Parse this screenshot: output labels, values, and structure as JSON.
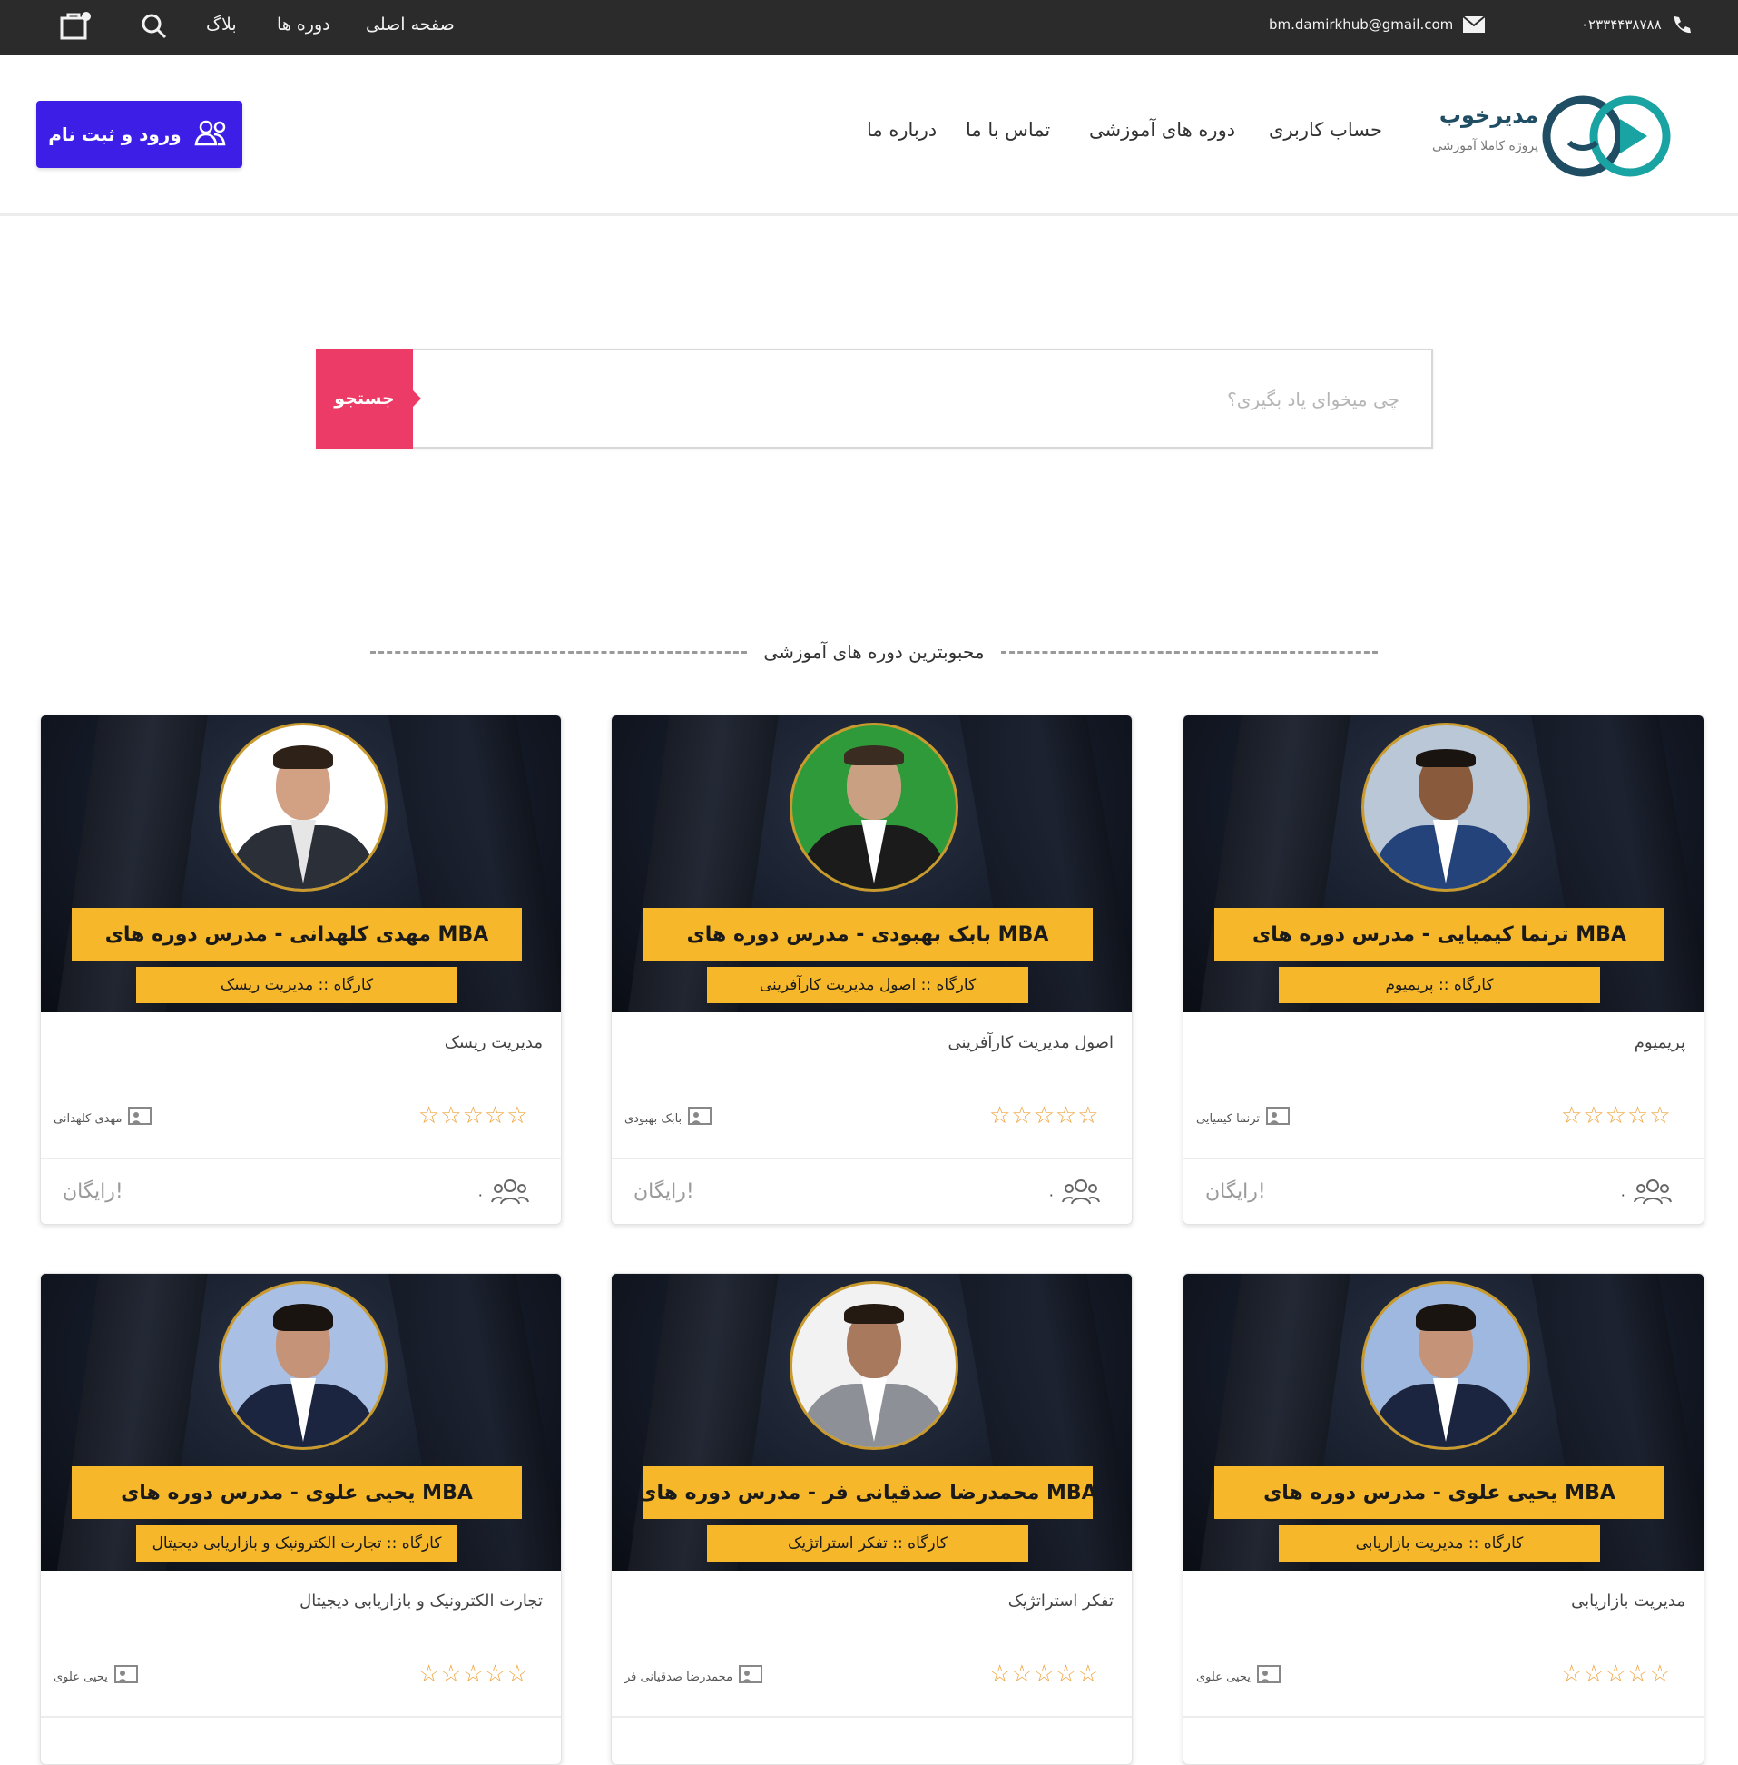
{
  "topbar": {
    "phone": "۰۲۳۳۴۴۳۸۷۸۸",
    "email": "bm.damirkhub@gmail.com",
    "links": [
      "صفحه اصلی",
      "دوره ها",
      "بلاگ"
    ]
  },
  "header": {
    "cta_label": "ورود و ثبت نام",
    "nav": [
      "حساب کاربری",
      "دوره های آموزشی",
      "تماس با ما",
      "درباره ما"
    ],
    "logo_title": "مدیرخوب",
    "logo_subtitle": "پروژه کاملا آموزشی"
  },
  "search": {
    "button_label": "جستجو",
    "placeholder": "چی میخوای یاد بگیری؟"
  },
  "section_title": "محبوبترین دوره های آموزشی",
  "colors": {
    "accent": "#3d1ee6",
    "search_button": "#ec3b66",
    "ribbon": "#f6b82a",
    "star": "#f0a23a",
    "topbar": "#2b2b2b"
  },
  "courses": [
    {
      "ribbon1": "مهدی کلهدانی - مدرس دوره های MBA",
      "ribbon2": "کارگاه :: مدیریت ریسک",
      "title": "مدیریت ریسک",
      "teacher": "مهدی کلهدانی",
      "students": "۰",
      "price": "رایگان!",
      "rating": "☆☆☆☆☆"
    },
    {
      "ribbon1": "بابک بهبودی - مدرس دوره های MBA",
      "ribbon2": "کارگاه :: اصول مدیریت کارآفرینی",
      "title": "اصول مدیریت کارآفرینی",
      "teacher": "بابک بهبودی",
      "students": "۰",
      "price": "رایگان!",
      "rating": "☆☆☆☆☆"
    },
    {
      "ribbon1": "ترنما کیمیایی - مدرس دوره های MBA",
      "ribbon2": "کارگاه :: پریمیوم",
      "title": "پریمیوم",
      "teacher": "ترنما کیمیایی",
      "students": "۰",
      "price": "رایگان!",
      "rating": "☆☆☆☆☆"
    },
    {
      "ribbon1": "یحیی علوی - مدرس دوره های MBA",
      "ribbon2": "کارگاه :: تجارت الکترونیک و بازاریابی دیجیتال",
      "title": "تجارت الکترونیک و بازاریابی دیجیتال",
      "teacher": "یحیی علوی",
      "rating": "☆☆☆☆☆"
    },
    {
      "ribbon1": "محمدرضا صدقیانی فر - مدرس دوره های MBA",
      "ribbon2": "کارگاه :: تفکر استراتژیک",
      "title": "تفکر استراتژیک",
      "teacher": "محمدرضا صدقیانی فر",
      "rating": "☆☆☆☆☆"
    },
    {
      "ribbon1": "یحیی علوی - مدرس دوره های MBA",
      "ribbon2": "کارگاه :: مدیریت بازاریابی",
      "title": "مدیریت بازاریابی",
      "teacher": "یحیی علوی",
      "rating": "☆☆☆☆☆"
    }
  ]
}
